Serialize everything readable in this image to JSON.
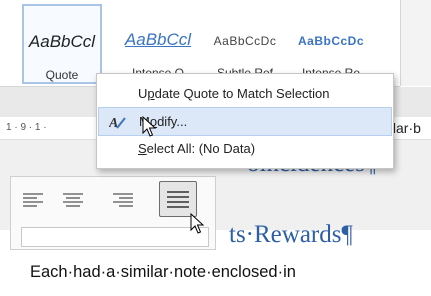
{
  "styles_gallery": {
    "tiles": [
      {
        "preview": "AaBbCcl",
        "name": "Quote"
      },
      {
        "preview": "AaBbCcl",
        "name": "Intense Q"
      },
      {
        "preview": "AaBbCcDc",
        "name": "Subtle Ref"
      },
      {
        "preview": "AaBbCcDc",
        "name": "Intense Re"
      }
    ]
  },
  "ruler": {
    "marks": "1 · 9 · 1 ·",
    "snippet": "nilar·b"
  },
  "document": {
    "heading1": "oincidences¶",
    "heading2": "ts·Rewards¶",
    "body": "Each·had·a·similar·note·enclosed·in"
  },
  "context_menu": {
    "items": [
      {
        "label_pre": "U",
        "label_ul": "p",
        "label_post": "date Quote to Match Selection"
      },
      {
        "label_pre": "M",
        "label_ul": "o",
        "label_post": "dify..."
      },
      {
        "label_pre": "",
        "label_ul": "S",
        "label_post": "elect All: (No Data)"
      }
    ]
  },
  "colors": {
    "accent_blue": "#2e5fa5",
    "menu_highlight": "#dce8f8"
  }
}
